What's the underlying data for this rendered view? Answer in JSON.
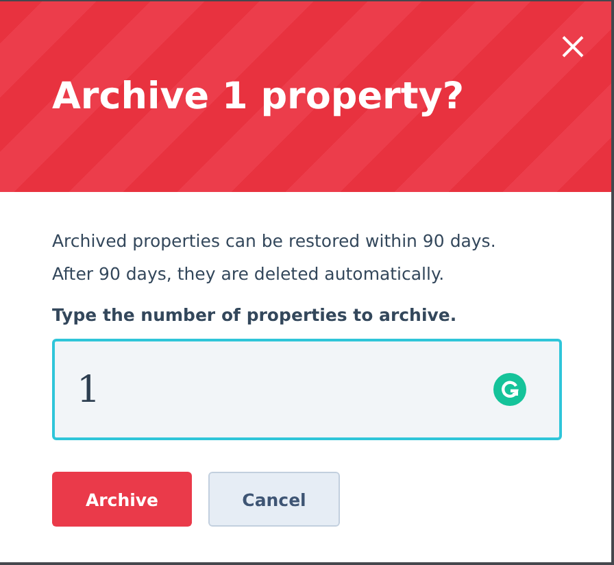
{
  "dialog": {
    "title": "Archive 1 property?",
    "message_lines": [
      "Archived properties can be restored within 90 days.",
      "After 90 days, they are deleted automatically."
    ],
    "field": {
      "label": "Type the number of properties to archive.",
      "value": "1"
    },
    "buttons": [
      {
        "label": "Archive",
        "kind": "primary"
      },
      {
        "label": "Cancel",
        "kind": "secondary"
      }
    ]
  }
}
